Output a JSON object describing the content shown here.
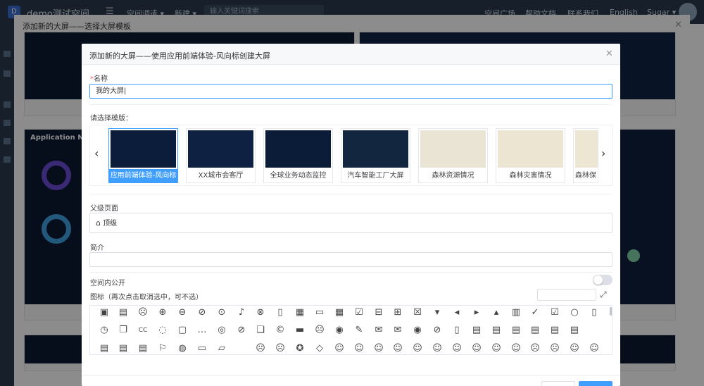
{
  "app": {
    "logo_letter": "D",
    "title": "demo测试空间",
    "nav_left": [
      "空间调遣",
      "新建"
    ],
    "search_placeholder": "输入关键词搜索",
    "nav_right": [
      "空间广场",
      "帮助文档",
      "联系我们",
      "English",
      "Sugar"
    ]
  },
  "outer_modal": {
    "title": "添加新的大屏——选择大屏模板",
    "dash_label": "Application Nam"
  },
  "modal": {
    "title": "添加新的大屏——使用应用前端体验-风向标创建大屏",
    "name_label": "名称",
    "name_required": "*",
    "name_value": "我的大屏",
    "template_label": "请选择模版：",
    "templates": [
      {
        "label": "应用前端体验-风向标",
        "selected": true
      },
      {
        "label": "XX城市会客厅",
        "selected": false
      },
      {
        "label": "全球业务动态监控",
        "selected": false
      },
      {
        "label": "汽车智能工厂大屏",
        "selected": false
      },
      {
        "label": "森林资源情况",
        "selected": false
      },
      {
        "label": "森林灾害情况",
        "selected": false
      },
      {
        "label": "森林保",
        "selected": false
      }
    ],
    "parent_label": "父级页面",
    "parent_value": "顶级",
    "intro_label": "简介",
    "intro_value": "",
    "public_label": "空间内公开",
    "public_enabled": false,
    "icon_label": "图标（再次点击取消选中，可不选）",
    "icon_search_value": ""
  },
  "colors": {
    "primary": "#409eff",
    "topbar": "#2b3a4d",
    "required": "#f56c6c"
  },
  "icons": {
    "row1": [
      "contact-card-icon",
      "id-card-icon",
      "sad-face-icon",
      "arrow-down-circle-icon",
      "arrow-left-circle-icon",
      "arrow-right-circle-icon",
      "arrow-up-circle-icon",
      "bell-icon",
      "bell-off-icon",
      "bookmark-icon",
      "building-icon",
      "calendar-icon",
      "calendar-grid-icon",
      "calendar-check-icon",
      "calendar-minus-icon",
      "calendar-plus-icon",
      "calendar-x-icon",
      "caret-down-square-icon",
      "caret-left-square-icon",
      "caret-right-square-icon",
      "caret-up-square-icon",
      "bar-chart-icon",
      "check-circle-icon",
      "check-square-icon",
      "circle-icon",
      "clipboard-icon"
    ],
    "row2": [
      "clock-icon",
      "copy-icon",
      "cc-icon",
      "chat-bubble-icon",
      "chat-square-icon",
      "chat-dots-icon",
      "chats-icon",
      "compass-icon",
      "files-icon",
      "copyright-icon",
      "credit-card-icon",
      "sad-face-2-icon",
      "record-circle-icon",
      "edit-icon",
      "envelope-icon",
      "envelope-open-icon",
      "eye-icon",
      "eye-off-icon",
      "file-icon",
      "file-text-icon",
      "file-excel-icon",
      "file-code-icon",
      "file-x-icon",
      "file-image-icon",
      "file-pdf-icon"
    ],
    "row3": [
      "file-ppt-icon",
      "file-slides-icon",
      "file-word-icon",
      "flag-icon",
      "hdd-icon",
      "folder-icon",
      "folder-open-icon",
      "frown-icon",
      "angry-icon",
      "star-face-icon",
      "gem-icon",
      "grimace-icon",
      "grin-icon",
      "grin-beam-icon",
      "grin-wink-icon",
      "grin-stars-icon",
      "grin-tongue-icon",
      "grin-squint-icon",
      "grin-tears-icon",
      "laugh-icon",
      "meh-icon",
      "frown-open-icon",
      "sad-tear-icon",
      "smile-icon"
    ]
  }
}
